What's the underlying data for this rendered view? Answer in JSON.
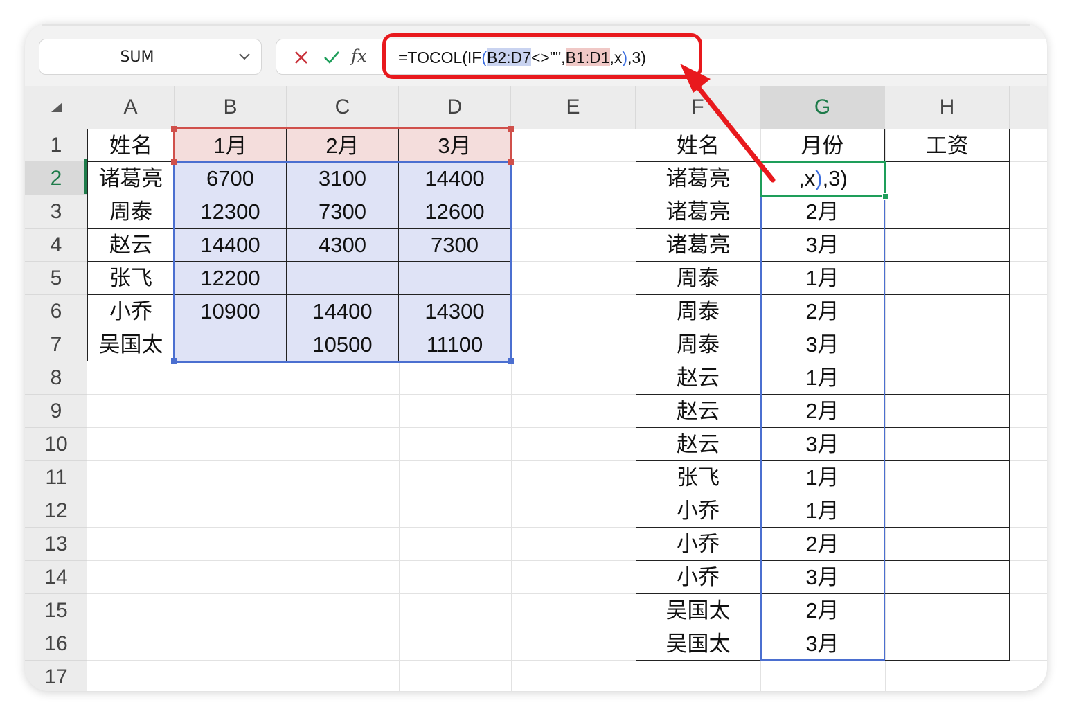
{
  "namebox": {
    "value": "SUM"
  },
  "formula_bar": {
    "fx_label": "fx",
    "formula_parts": [
      "=TOCOL(IF",
      "(",
      "B2:D7",
      "<>\"\",",
      "B1:D1",
      ",x",
      ")",
      ",3)"
    ]
  },
  "columns": [
    "A",
    "B",
    "C",
    "D",
    "E",
    "F",
    "G",
    "H"
  ],
  "rows": [
    "1",
    "2",
    "3",
    "4",
    "5",
    "6",
    "7",
    "8",
    "9",
    "10",
    "11",
    "12",
    "13",
    "14",
    "15",
    "16",
    "17"
  ],
  "left_table": {
    "header": [
      "姓名",
      "1月",
      "2月",
      "3月"
    ],
    "rows": [
      [
        "诸葛亮",
        "6700",
        "3100",
        "14400"
      ],
      [
        "周泰",
        "12300",
        "7300",
        "12600"
      ],
      [
        "赵云",
        "14400",
        "4300",
        "7300"
      ],
      [
        "张飞",
        "12200",
        "",
        ""
      ],
      [
        "小乔",
        "10900",
        "14400",
        "14300"
      ],
      [
        "吴国太",
        "",
        "10500",
        "11100"
      ]
    ]
  },
  "right_table": {
    "header": [
      "姓名",
      "月份",
      "工资"
    ],
    "editing_cell_parts": [
      ",x",
      ")",
      ",3)"
    ],
    "rows": [
      [
        "诸葛亮",
        ""
      ],
      [
        "诸葛亮",
        "2月"
      ],
      [
        "诸葛亮",
        "3月"
      ],
      [
        "周泰",
        "1月"
      ],
      [
        "周泰",
        "2月"
      ],
      [
        "周泰",
        "3月"
      ],
      [
        "赵云",
        "1月"
      ],
      [
        "赵云",
        "2月"
      ],
      [
        "赵云",
        "3月"
      ],
      [
        "张飞",
        "1月"
      ],
      [
        "小乔",
        "1月"
      ],
      [
        "小乔",
        "2月"
      ],
      [
        "小乔",
        "3月"
      ],
      [
        "吴国太",
        "2月"
      ],
      [
        "吴国太",
        "3月"
      ]
    ]
  },
  "colors": {
    "accent_green": "#1e9e5a",
    "ref_blue": "#4b6fd0",
    "ref_red": "#d0504b",
    "annotation_red": "#e8191d"
  },
  "icons": [
    "cancel-icon",
    "enter-check-icon",
    "fx-icon",
    "chevron-down-icon",
    "select-all-icon",
    "annotation-arrow-icon"
  ]
}
